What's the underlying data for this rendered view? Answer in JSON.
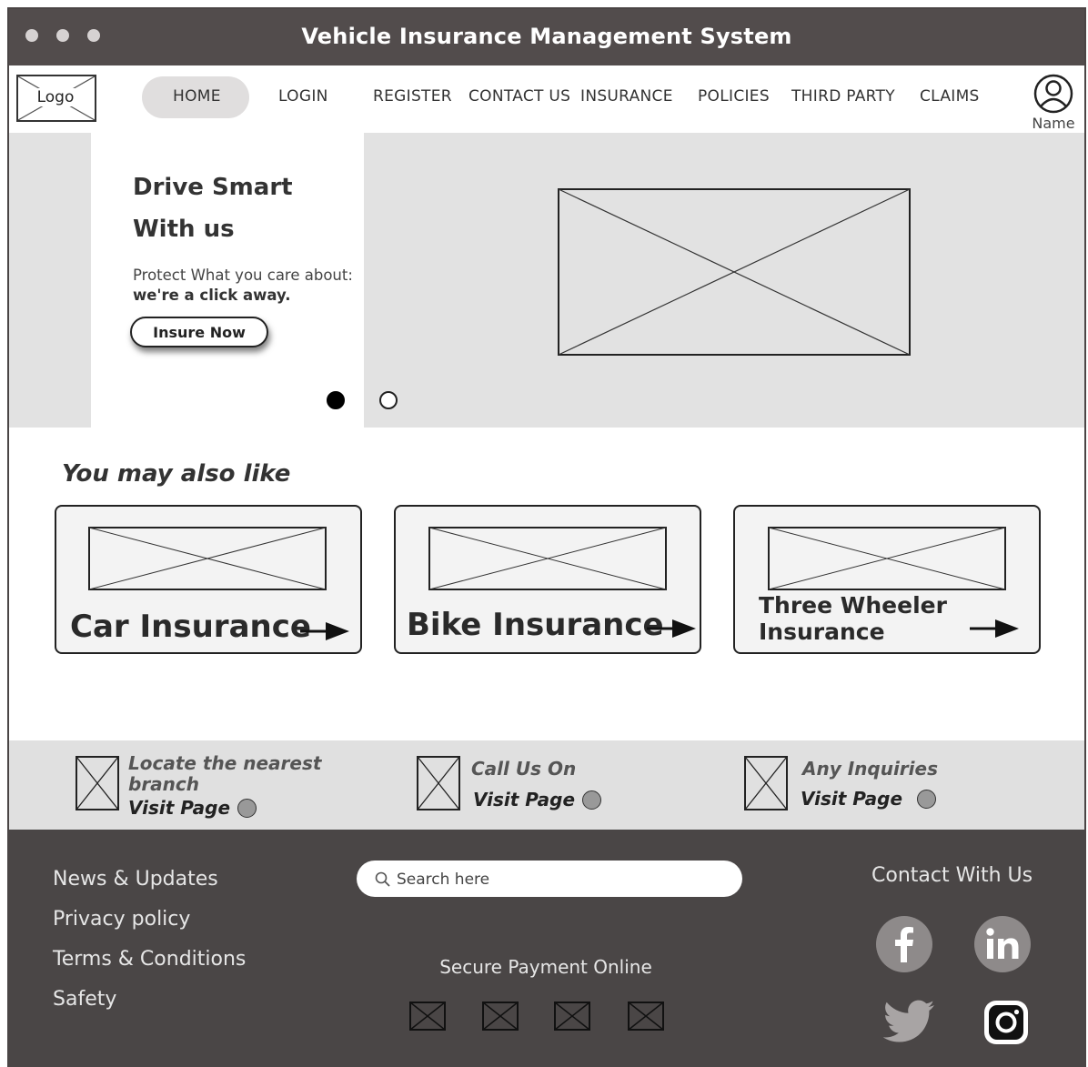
{
  "window": {
    "title": "Vehicle Insurance Management System"
  },
  "nav": {
    "logo": "Logo",
    "items": [
      "HOME",
      "LOGIN",
      "REGISTER",
      "CONTACT US",
      "INSURANCE",
      "POLICIES",
      "THIRD PARTY",
      "CLAIMS"
    ],
    "active": "HOME",
    "user_name": "Name"
  },
  "hero": {
    "title_line1": "Drive Smart",
    "title_line2": "With us",
    "sub_line1": "Protect What you care about:",
    "sub_line2": "we're a click away.",
    "button": "Insure Now",
    "slides_total": 2,
    "slide_active": 1
  },
  "recommend": {
    "title": "You may also like",
    "cards": [
      {
        "label": "Car Insurance"
      },
      {
        "label": "Bike Insurance"
      },
      {
        "label_line1": "Three Wheeler",
        "label_line2": "Insurance"
      }
    ]
  },
  "info": [
    {
      "title_line1": "Locate the nearest",
      "title_line2": "branch",
      "link": "Visit Page"
    },
    {
      "title_line1": "Call Us On",
      "link": "Visit Page"
    },
    {
      "title_line1": "Any Inquiries",
      "link": "Visit Page"
    }
  ],
  "footer": {
    "links": [
      "News & Updates",
      "Privacy policy",
      "Terms & Conditions",
      "Safety"
    ],
    "search_placeholder": "Search here",
    "secure_payment": "Secure Payment Online",
    "payment_icons": [
      "payment-placeholder-icon",
      "payment-placeholder-icon",
      "payment-placeholder-icon",
      "payment-placeholder-icon"
    ],
    "contact_title": "Contact With Us",
    "social": [
      "facebook-icon",
      "linkedin-icon",
      "twitter-icon",
      "instagram-icon"
    ]
  },
  "colors": {
    "titlebar": "#524c4c",
    "footer": "#4a4646",
    "hero_bg": "#e2e2e2",
    "info_band": "#e0e0e0"
  }
}
